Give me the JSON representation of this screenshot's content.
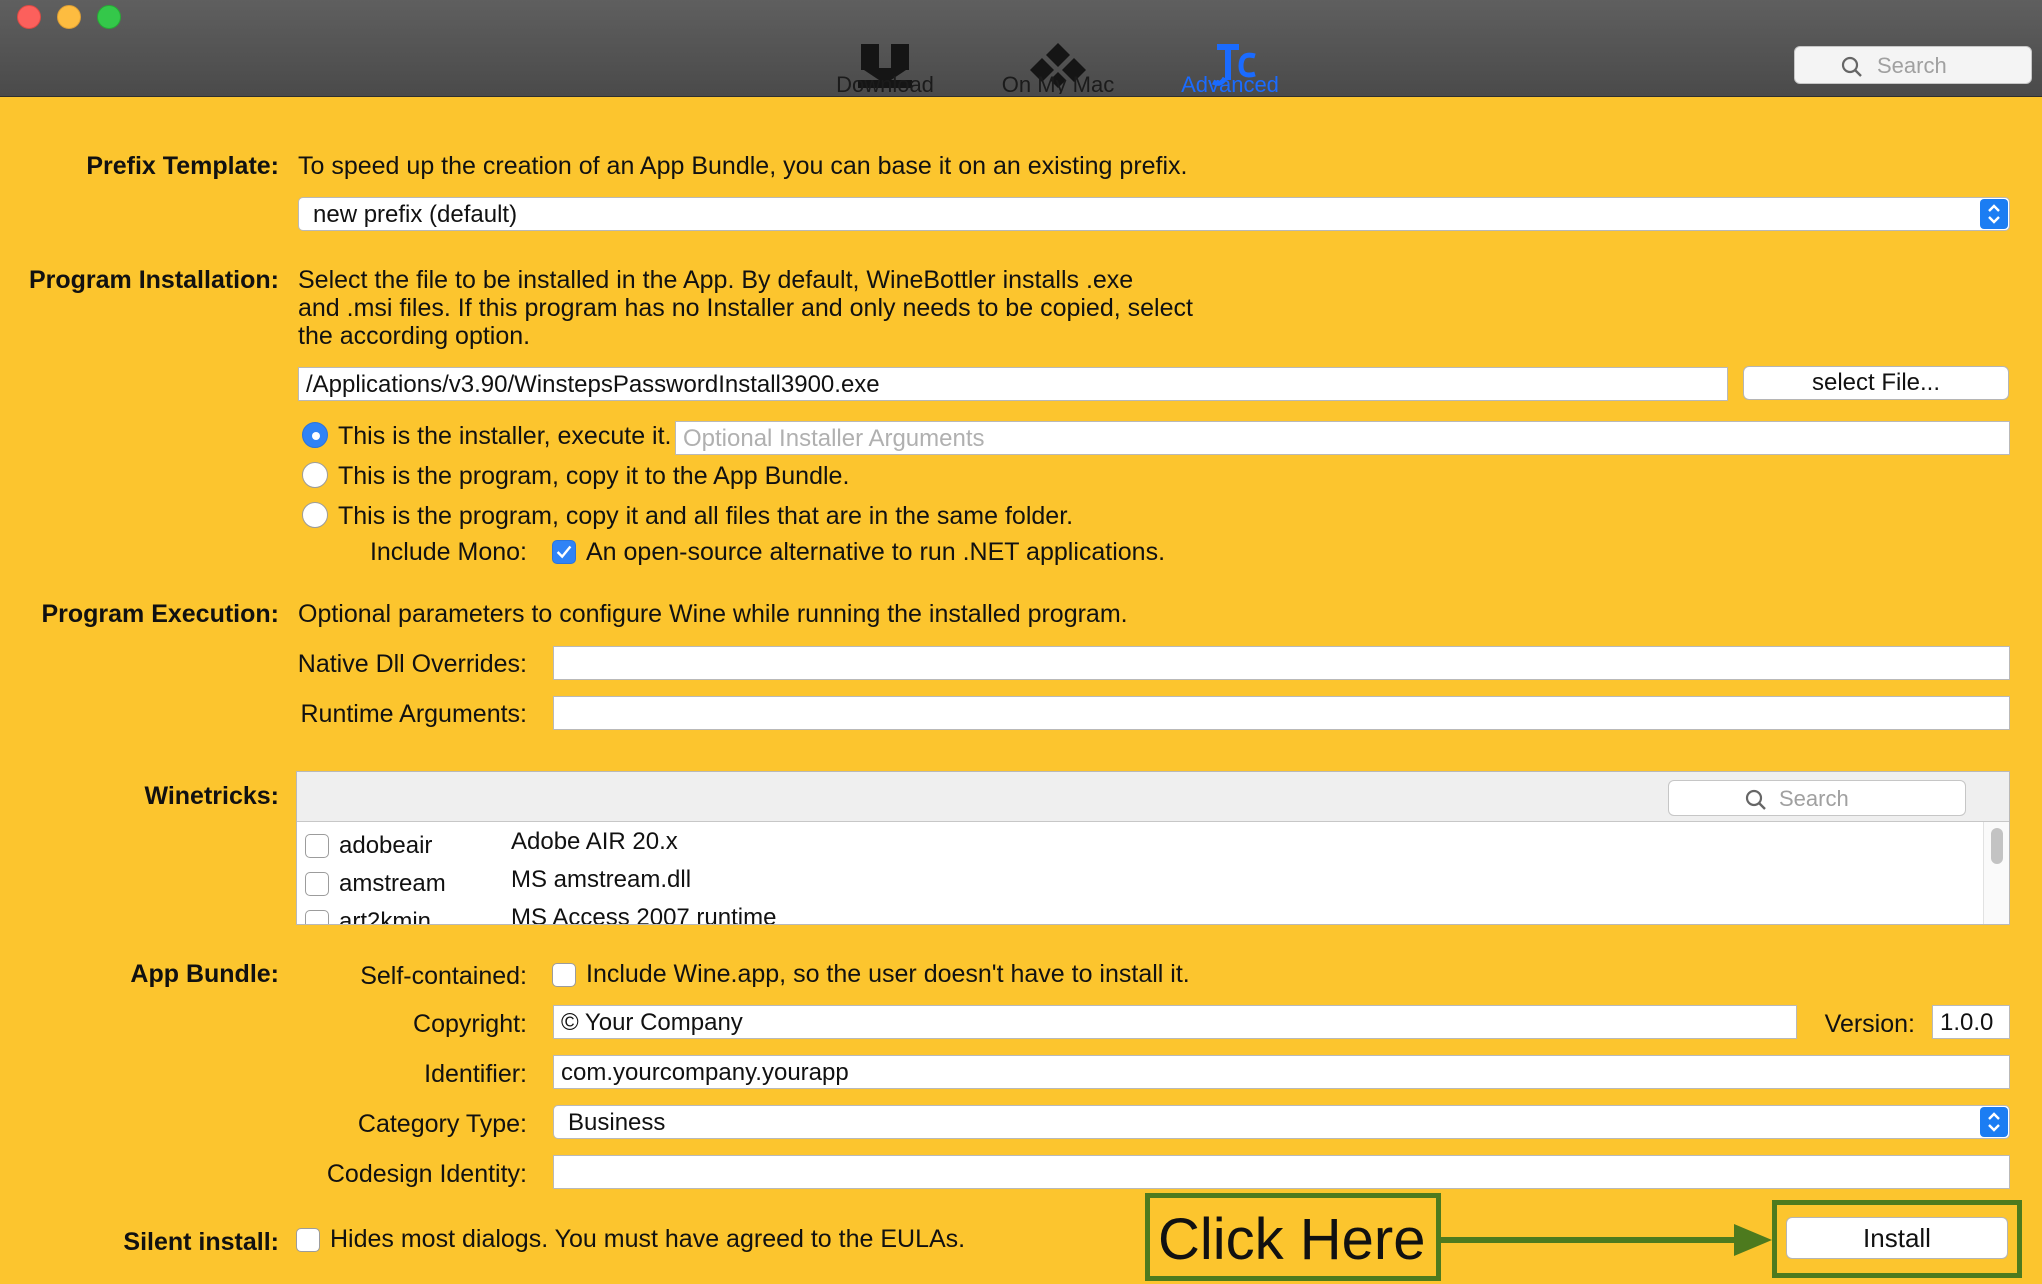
{
  "window": {
    "tabs": [
      {
        "label": "Download",
        "icon": "download-icon",
        "active": false
      },
      {
        "label": "On My Mac",
        "icon": "on-my-mac-icon",
        "active": false
      },
      {
        "label": "Advanced",
        "icon": "advanced-icon",
        "active": true
      }
    ],
    "search_placeholder": "Search"
  },
  "colors": {
    "background": "#fcc52e",
    "accent": "#2f83f6",
    "annotation": "#4d7a1e"
  },
  "prefix_template": {
    "label": "Prefix Template:",
    "description": "To speed up the creation of an App Bundle, you can base it on an existing prefix.",
    "selected": "new prefix (default)"
  },
  "program_installation": {
    "label": "Program Installation:",
    "description_lines": [
      "Select the file to be installed in the App. By default, WineBottler installs .exe",
      "and .msi files. If this program has no Installer and only needs to be copied, select",
      "the according option."
    ],
    "file_path": "/Applications/v3.90/WinstepsPasswordInstall3900.exe",
    "select_file_button": "select File...",
    "options": [
      {
        "label": "This is the installer, execute it.",
        "selected": true
      },
      {
        "label": "This is the program, copy it to the App Bundle.",
        "selected": false
      },
      {
        "label": "This is the program, copy it and all files that are in the same folder.",
        "selected": false
      }
    ],
    "installer_args_placeholder": "Optional Installer Arguments",
    "include_mono_label": "Include Mono:",
    "include_mono_text": "An open-source alternative to run .NET applications.",
    "include_mono_checked": true
  },
  "program_execution": {
    "label": "Program Execution:",
    "description": "Optional parameters to configure Wine while running the installed program.",
    "native_dll_label": "Native Dll Overrides:",
    "native_dll_value": "",
    "runtime_args_label": "Runtime Arguments:",
    "runtime_args_value": ""
  },
  "winetricks": {
    "label": "Winetricks:",
    "search_placeholder": "Search",
    "items": [
      {
        "name": "adobeair",
        "description": "Adobe AIR 20.x",
        "checked": false
      },
      {
        "name": "amstream",
        "description": "MS amstream.dll",
        "checked": false
      },
      {
        "name": "art2kmin",
        "description": "MS Access 2007 runtime",
        "checked": false
      }
    ]
  },
  "app_bundle": {
    "label": "App Bundle:",
    "self_contained_label": "Self-contained:",
    "self_contained_text": "Include Wine.app, so the user doesn't have to install it.",
    "self_contained_checked": false,
    "copyright_label": "Copyright:",
    "copyright_value": "© Your Company",
    "version_label": "Version:",
    "version_value": "1.0.0",
    "identifier_label": "Identifier:",
    "identifier_value": "com.yourcompany.yourapp",
    "category_label": "Category Type:",
    "category_value": "Business",
    "codesign_label": "Codesign Identity:",
    "codesign_value": ""
  },
  "silent_install": {
    "label": "Silent install:",
    "text": "Hides most dialogs. You must have agreed to the EULAs.",
    "checked": false
  },
  "install_button": "Install",
  "annotation": {
    "text": "Click Here"
  }
}
